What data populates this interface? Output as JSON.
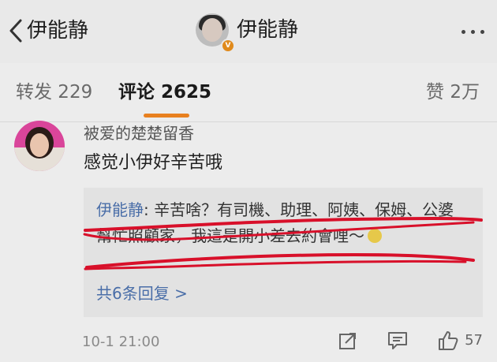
{
  "header": {
    "back_label": "伊能静",
    "title": "伊能静",
    "verified_badge": "V"
  },
  "tabs": {
    "repost": "转发 229",
    "comment": "评论 2625",
    "like": "赞 2万"
  },
  "comment": {
    "username": "被爱的楚楚留香",
    "text": "感觉小伊好辛苦哦",
    "reply": {
      "author": "伊能静",
      "separator": ": ",
      "text": "辛苦啥？有司機、助理、阿姨、保姆、公婆幫忙照顧家，我這是開小差去約會哩～",
      "view_replies": "共6条回复 >"
    },
    "time": "10-1 21:00",
    "like_count": "57"
  },
  "colors": {
    "accent": "#e8801f",
    "link": "#4a6ea8",
    "annotation": "#d8102a"
  }
}
